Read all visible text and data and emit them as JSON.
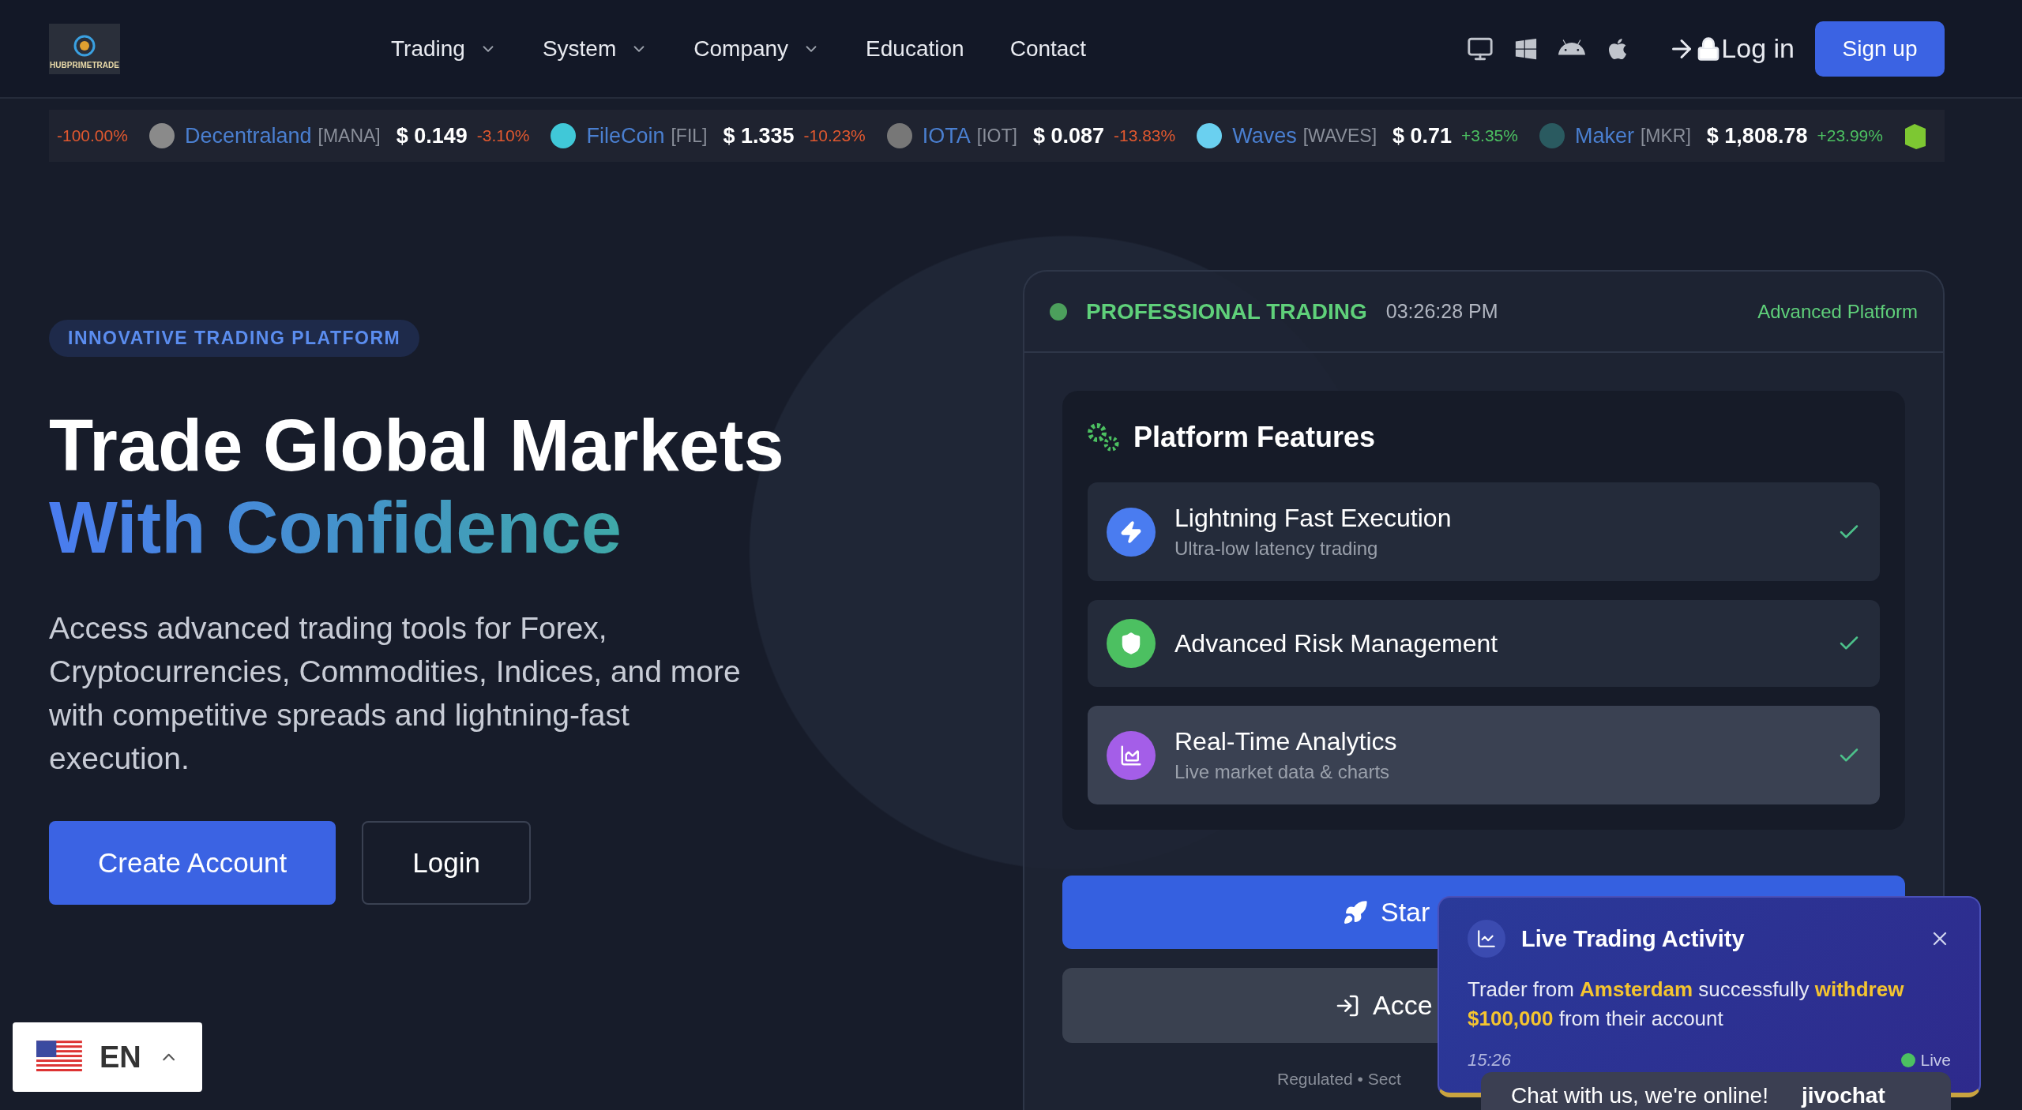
{
  "header": {
    "logo": "HUBPRIMETRADE",
    "nav": [
      {
        "label": "Trading",
        "dropdown": true
      },
      {
        "label": "System",
        "dropdown": true
      },
      {
        "label": "Company",
        "dropdown": true
      },
      {
        "label": "Education",
        "dropdown": false
      },
      {
        "label": "Contact",
        "dropdown": false
      }
    ],
    "login": "Log in",
    "signup": "Sign up"
  },
  "ticker": [
    {
      "kind": "partial",
      "change": "-100.00%",
      "color": "#e0582f"
    },
    {
      "kind": "coin",
      "name": "Decentraland",
      "symbol": "[MANA]",
      "price": "$ 0.149",
      "change": "-3.10%",
      "color": "#e0582f"
    },
    {
      "kind": "coin",
      "name": "FileCoin",
      "symbol": "[FIL]",
      "price": "$ 1.335",
      "change": "-10.23%",
      "color": "#e0582f"
    },
    {
      "kind": "coin",
      "name": "IOTA",
      "symbol": "[IOT]",
      "price": "$ 0.087",
      "change": "-13.83%",
      "color": "#e0582f"
    },
    {
      "kind": "coin",
      "name": "Waves",
      "symbol": "[WAVES]",
      "price": "$ 0.71",
      "change": "+3.35%",
      "color": "#4cc061"
    },
    {
      "kind": "coin",
      "name": "Maker",
      "symbol": "[MKR]",
      "price": "$ 1,808.78",
      "change": "+23.99%",
      "color": "#4cc061"
    }
  ],
  "hero": {
    "badge": "INNOVATIVE TRADING PLATFORM",
    "title_line1": "Trade Global Markets",
    "title_line2": "With Confidence",
    "description": "Access advanced trading tools for Forex, Cryptocurrencies, Commodities, Indices, and more with competitive spreads and lightning-fast execution.",
    "buttons": [
      {
        "label": "Create Account",
        "kind": "primary"
      },
      {
        "label": "Login",
        "kind": "outline"
      }
    ]
  },
  "card": {
    "status": "PROFESSIONAL TRADING",
    "time": "03:26:28 PM",
    "platform": "Advanced Platform",
    "features": {
      "title": "Platform Features",
      "items": [
        {
          "title": "Lightning Fast Execution",
          "subtitle": "Ultra-low latency trading",
          "kind": "bolt",
          "color": "#4a7cf0",
          "highlighted": false,
          "checked": true
        },
        {
          "title": "Advanced Risk Management",
          "kind": "shield",
          "color": "#4cc061",
          "highlighted": false,
          "checked": true
        },
        {
          "title": "Real-Time Analytics",
          "subtitle": "Live market data & charts",
          "kind": "chart",
          "color": "#a45ee8",
          "highlighted": true,
          "checked": true
        }
      ]
    },
    "actions": [
      {
        "label": "Star",
        "kind": "primary"
      },
      {
        "label": "Acce",
        "kind": "secondary"
      }
    ],
    "note": "Regulated • Sect"
  },
  "popup": {
    "title": "Live Trading Activity",
    "message": "Trader from **Amsterdam** successfully **withdrew** **$100,000** from their account",
    "time": "15:26",
    "status": "Live"
  },
  "chat": {
    "text": "Chat with us, we're online!",
    "brand": "jivochat"
  },
  "language": {
    "code": "EN"
  }
}
